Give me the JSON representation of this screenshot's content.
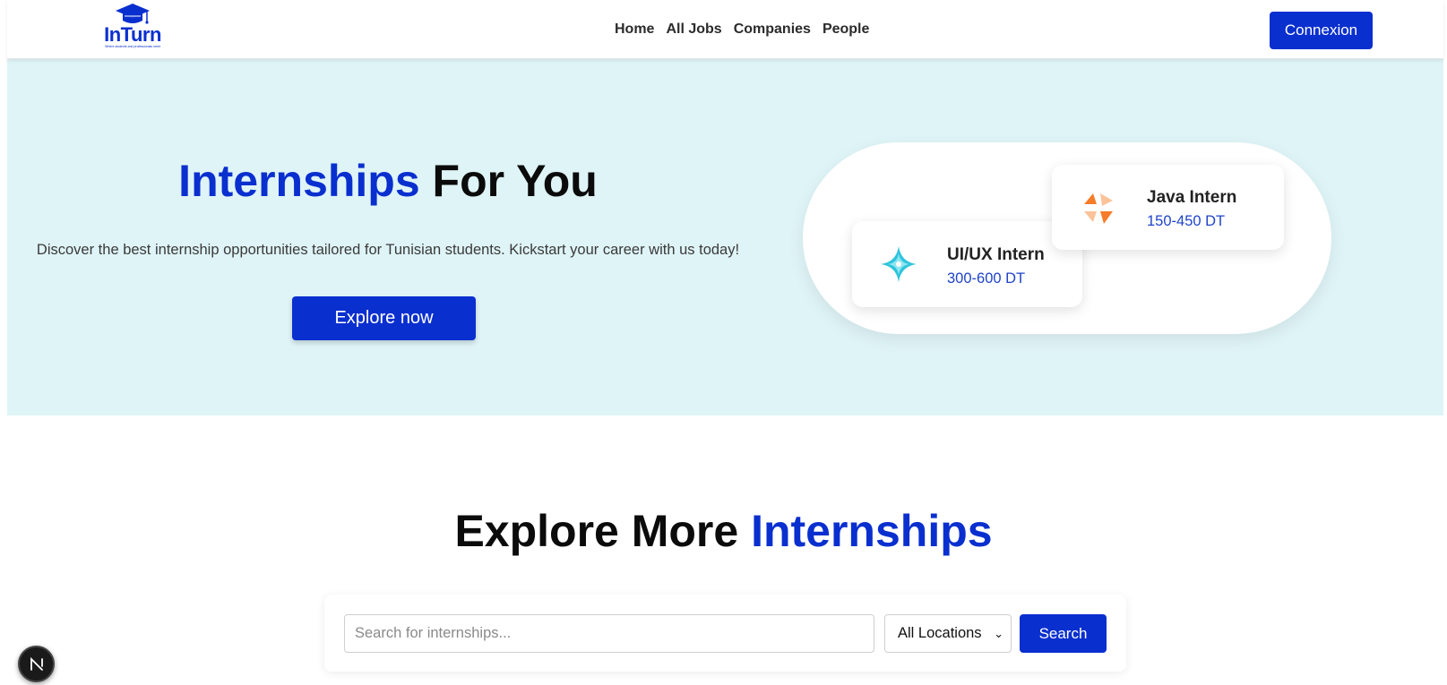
{
  "brand": {
    "name": "InTurn",
    "tagline": "Where students and professionals meet",
    "accent_color": "#0a2fcf"
  },
  "nav": {
    "links": [
      {
        "label": "Home"
      },
      {
        "label": "All Jobs"
      },
      {
        "label": "Companies"
      },
      {
        "label": "People"
      }
    ],
    "login_label": "Connexion"
  },
  "hero": {
    "title_accent": "Internships",
    "title_rest": " For You",
    "description": "Discover the best internship opportunities tailored for Tunisian students. Kickstart your career with us today!",
    "cta_label": "Explore now",
    "background_color": "#dff4f7"
  },
  "featured_jobs": [
    {
      "title": "Java Intern",
      "salary": "150-450 DT",
      "icon": "orange-abstract-logo-icon"
    },
    {
      "title": "UI/UX Intern",
      "salary": "300-600 DT",
      "icon": "cyan-star-logo-icon"
    }
  ],
  "explore": {
    "title_main": "Explore More ",
    "title_accent": "Internships"
  },
  "search": {
    "placeholder": "Search for internships...",
    "value": "",
    "location_selected": "All Locations",
    "button_label": "Search"
  },
  "dev_badge": {
    "letter": "N",
    "icon": "nextjs-dev-indicator-icon"
  }
}
